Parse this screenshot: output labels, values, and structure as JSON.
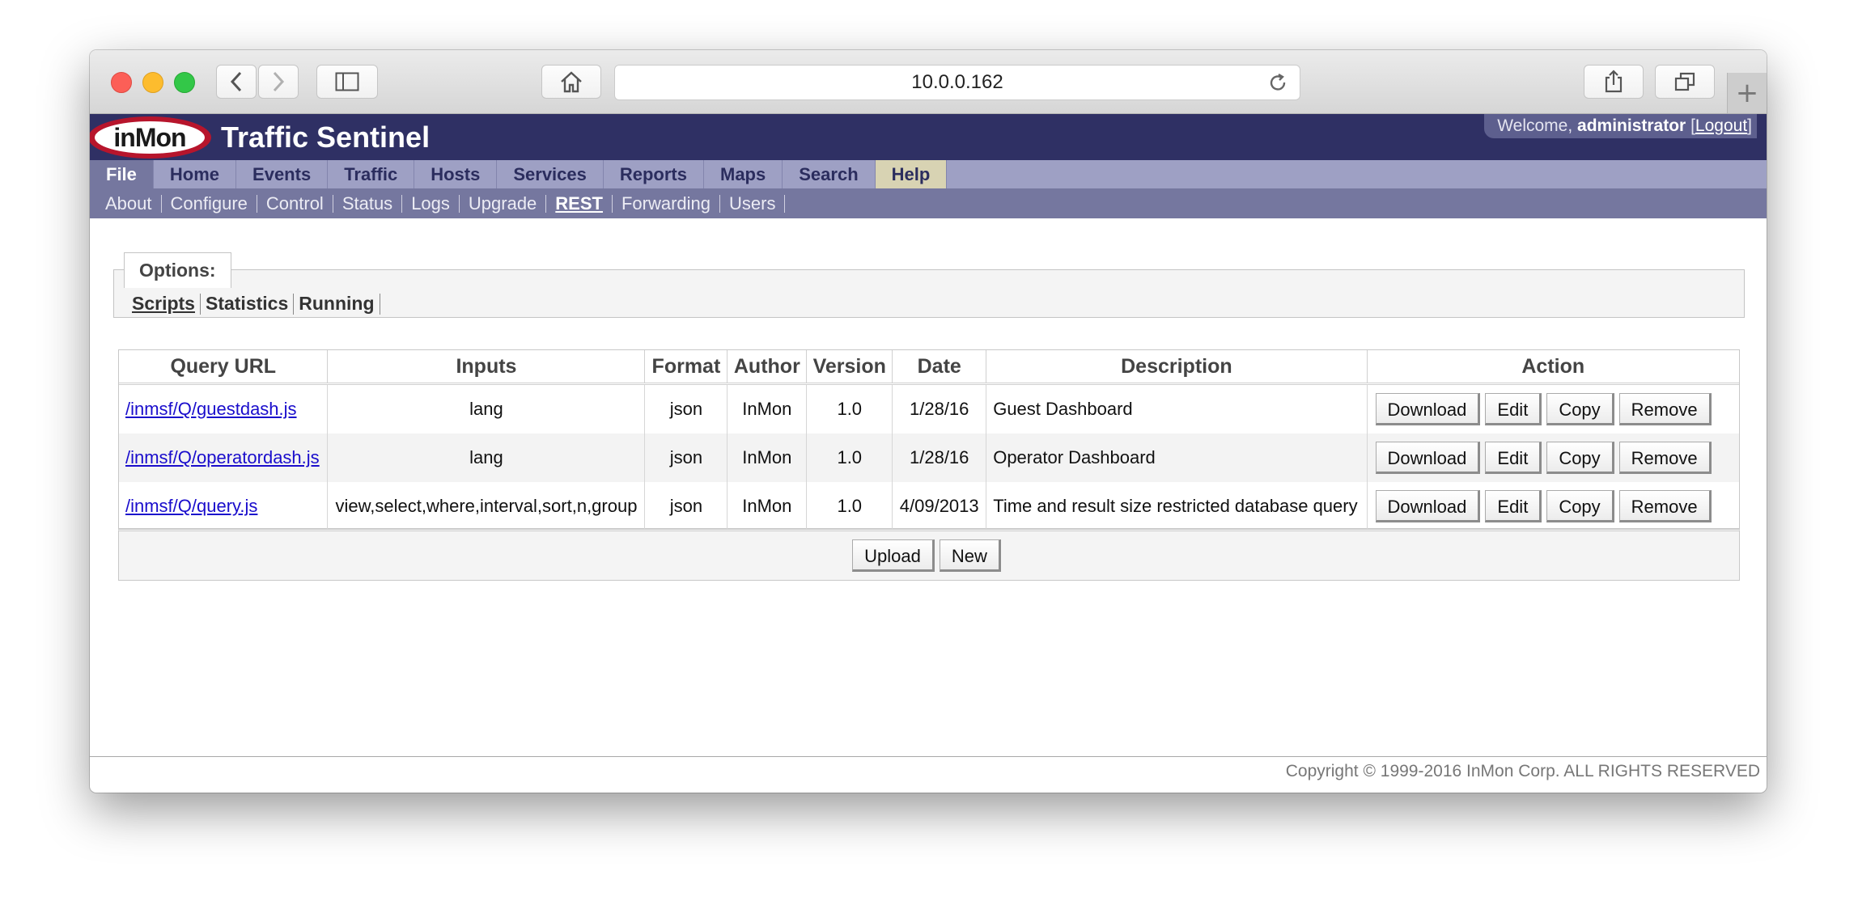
{
  "browser": {
    "url": "10.0.0.162",
    "newtab_label": "+"
  },
  "app": {
    "logo_text": "inMon",
    "title": "Traffic Sentinel",
    "welcome_prefix": "Welcome,",
    "username": "administrator",
    "logout_label": "Logout"
  },
  "mainnav": [
    {
      "label": "File",
      "active": true
    },
    {
      "label": "Home"
    },
    {
      "label": "Events"
    },
    {
      "label": "Traffic"
    },
    {
      "label": "Hosts"
    },
    {
      "label": "Services"
    },
    {
      "label": "Reports"
    },
    {
      "label": "Maps"
    },
    {
      "label": "Search"
    },
    {
      "label": "Help"
    }
  ],
  "subnav": [
    {
      "label": "About"
    },
    {
      "label": "Configure"
    },
    {
      "label": "Control"
    },
    {
      "label": "Status"
    },
    {
      "label": "Logs"
    },
    {
      "label": "Upgrade"
    },
    {
      "label": "REST",
      "active": true
    },
    {
      "label": "Forwarding"
    },
    {
      "label": "Users"
    }
  ],
  "options": {
    "legend": "Options:",
    "links": [
      "Scripts",
      "Statistics",
      "Running"
    ]
  },
  "table": {
    "headers": [
      "Query URL",
      "Inputs",
      "Format",
      "Author",
      "Version",
      "Date",
      "Description",
      "Action"
    ],
    "rows": [
      {
        "url": "/inmsf/Q/guestdash.js",
        "inputs": "lang",
        "format": "json",
        "author": "InMon",
        "version": "1.0",
        "date": "1/28/16",
        "description": "Guest Dashboard"
      },
      {
        "url": "/inmsf/Q/operatordash.js",
        "inputs": "lang",
        "format": "json",
        "author": "InMon",
        "version": "1.0",
        "date": "1/28/16",
        "description": "Operator Dashboard"
      },
      {
        "url": "/inmsf/Q/query.js",
        "inputs": "view,select,where,interval,sort,n,group",
        "format": "json",
        "author": "InMon",
        "version": "1.0",
        "date": "4/09/2013",
        "description": "Time and result size restricted database query"
      }
    ],
    "action_labels": {
      "download": "Download",
      "edit": "Edit",
      "copy": "Copy",
      "remove": "Remove"
    },
    "footer_buttons": {
      "upload": "Upload",
      "new": "New"
    }
  },
  "footer": {
    "copyright": "Copyright © 1999-2016 InMon Corp. ALL RIGHTS RESERVED"
  }
}
